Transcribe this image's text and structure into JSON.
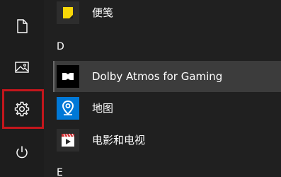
{
  "sidebar": {
    "items": [
      {
        "name": "documents",
        "icon": "document-icon"
      },
      {
        "name": "pictures",
        "icon": "pictures-icon"
      },
      {
        "name": "settings",
        "icon": "gear-icon",
        "highlighted": true
      },
      {
        "name": "power",
        "icon": "power-icon"
      }
    ],
    "highlight_color": "#c4161c"
  },
  "app_list": {
    "items": [
      {
        "label": "便笺",
        "icon": "sticky-notes-icon",
        "tile_color": "#2d2d2d"
      },
      {
        "label": "Dolby Atmos for Gaming",
        "icon": "dolby-icon",
        "tile_color": "#000000",
        "active": true
      },
      {
        "label": "地图",
        "icon": "maps-icon",
        "tile_color": "#0078d7"
      },
      {
        "label": "电影和电视",
        "icon": "movies-tv-icon",
        "tile_color": "#2d2d2d"
      }
    ],
    "headers": [
      {
        "letter": "D"
      },
      {
        "letter": "E"
      }
    ]
  },
  "colors": {
    "background": "#202020",
    "sticky_yellow": "#f7d708",
    "maps_blue": "#0078d7",
    "movies_red": "#d13438"
  }
}
